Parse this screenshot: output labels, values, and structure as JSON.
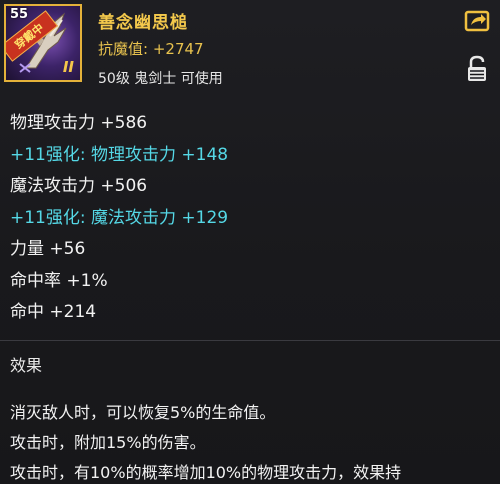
{
  "item": {
    "level_badge": "55",
    "equipped_tag": "穿戴中",
    "grade_mark": "II",
    "name": "善念幽思槌",
    "resist_label": "抗魔值:",
    "resist_value": "+2747",
    "requirement": "50级 鬼剑士 可使用",
    "icons": [
      "weapon-item-icon",
      "share-icon",
      "unlock-icon"
    ]
  },
  "stats": [
    {
      "text": "物理攻击力 +586",
      "type": "base"
    },
    {
      "text": "+11强化: 物理攻击力 +148",
      "type": "enhance"
    },
    {
      "text": "魔法攻击力 +506",
      "type": "base"
    },
    {
      "text": "+11强化: 魔法攻击力 +129",
      "type": "enhance"
    },
    {
      "text": "力量 +56",
      "type": "base"
    },
    {
      "text": "命中率 +1%",
      "type": "base"
    },
    {
      "text": "命中 +214",
      "type": "base"
    }
  ],
  "effect": {
    "title": "效果",
    "lines": [
      "消灭敌人时，可以恢复5%的生命值。",
      "攻击时，附加15%的伤害。",
      "攻击时，有10%的概率增加10%的物理攻击力，效果持"
    ]
  },
  "colors": {
    "name": "#f4c94c",
    "enhance": "#55d8e6",
    "text": "#f2f2f2",
    "icon_border": "#e4b23a"
  }
}
